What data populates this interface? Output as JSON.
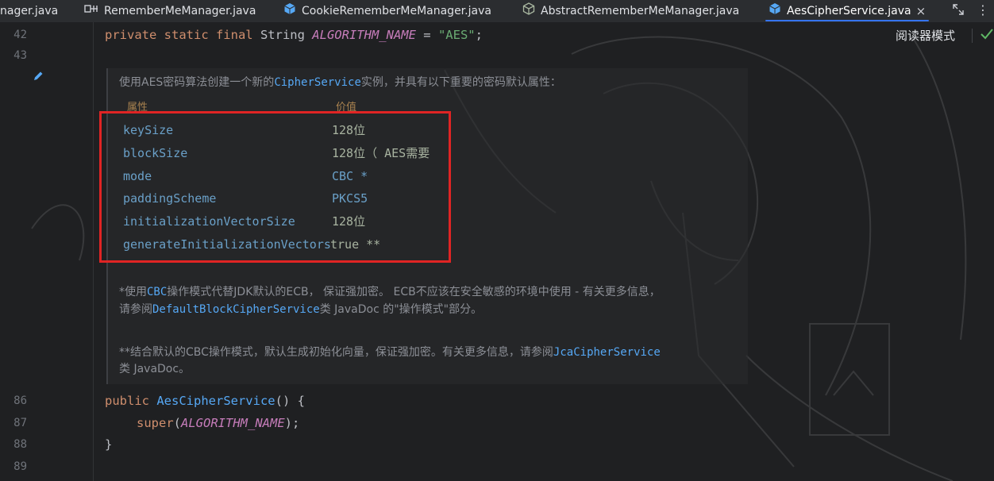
{
  "tabs": [
    {
      "label": "nager.java",
      "icon": "java-file-icon",
      "active": false
    },
    {
      "label": "RememberMeManager.java",
      "icon": "interface-icon",
      "active": false
    },
    {
      "label": "CookieRememberMeManager.java",
      "icon": "class-icon",
      "active": false
    },
    {
      "label": "AbstractRememberMeManager.java",
      "icon": "abstract-class-icon",
      "active": false
    },
    {
      "label": "AesCipherService.java",
      "icon": "class-icon",
      "active": true,
      "close": "×"
    }
  ],
  "reader_mode": "阅读器模式",
  "gutter": {
    "line_42": "42",
    "line_43": "43",
    "line_86": "86",
    "line_87": "87",
    "line_88": "88",
    "line_89": "89"
  },
  "code": {
    "l42": {
      "kw": "private static final ",
      "type": "String ",
      "name": "ALGORITHM_NAME",
      "eq": " = ",
      "str": "\"AES\"",
      "end": ";"
    },
    "l86": {
      "kw": "public ",
      "fn": "AesCipherService",
      "rest": "() {"
    },
    "l87": {
      "fn": "super",
      "open": "(",
      "arg": "ALGORITHM_NAME",
      "close": ");"
    },
    "l88": "}"
  },
  "doc": {
    "intro_pre": "使用AES密码算法创建一个新的",
    "intro_code": "CipherService",
    "intro_post": "实例，并具有以下重要的密码默认属性：",
    "head_property": "属性",
    "head_value": "价值",
    "rows": [
      {
        "property": "keySize",
        "value": "128位"
      },
      {
        "property": "blockSize",
        "value": "128位（ AES需要"
      },
      {
        "property": "mode",
        "value": "CBC *"
      },
      {
        "property": "paddingScheme",
        "value": "PKCS5"
      },
      {
        "property": "initializationVectorSize",
        "value": "128位"
      },
      {
        "property": "generateInitializationVectors",
        "value": "true **"
      }
    ],
    "note1_pre": "*使用",
    "note1_code": "CBC",
    "note1_post": "操作模式代替JDK默认的ECB， 保证强加密。 ECB不应该在安全敏感的环境中使用 - 有关更多信息，",
    "note1b_pre": "请参阅",
    "note1b_code": "DefaultBlockCipherService",
    "note1b_post": "类 JavaDoc 的\"操作模式\"部分。",
    "note2_pre": "**结合默认的CBC操作模式，默认生成初始化向量，保证强加密。有关更多信息，请参阅",
    "note2_code": "JcaCipherService",
    "note2b": "类 JavaDoc。"
  },
  "colors": {
    "highlight_box": "#e02424",
    "accent_tab": "#3574f0"
  }
}
